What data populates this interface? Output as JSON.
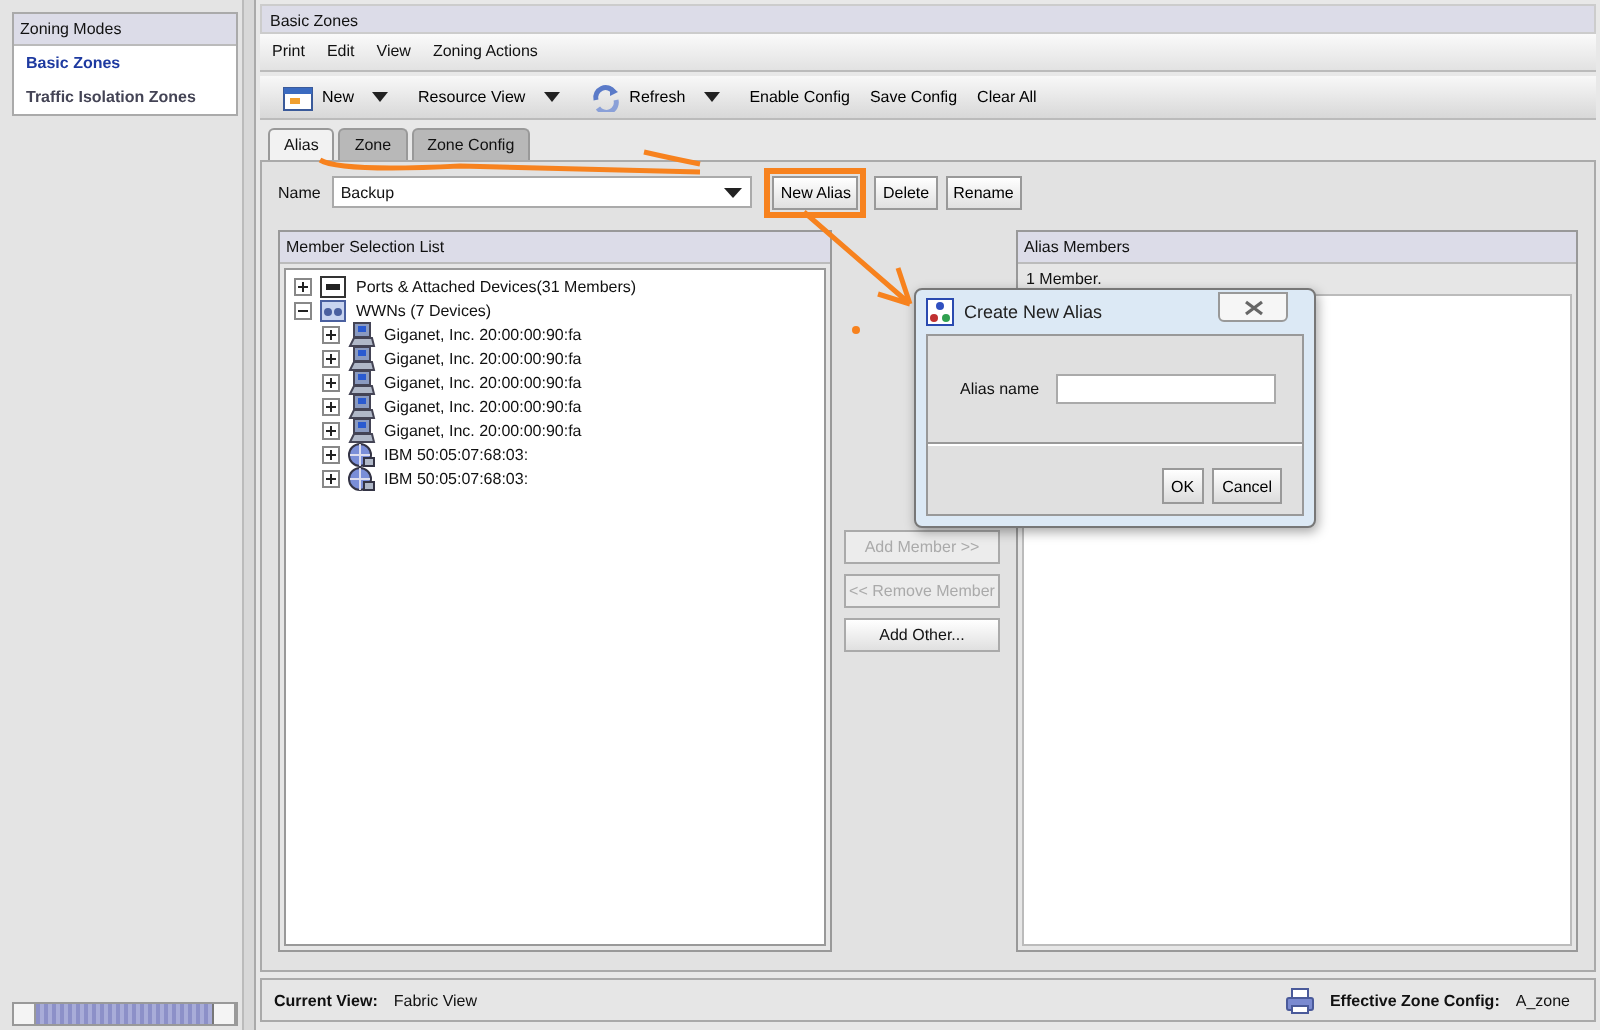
{
  "sidebar": {
    "title": "Zoning Modes",
    "items": [
      {
        "label": "Basic Zones",
        "selected": true
      },
      {
        "label": "Traffic Isolation Zones",
        "selected": false
      }
    ]
  },
  "main": {
    "title": "Basic Zones",
    "menu": [
      "Print",
      "Edit",
      "View",
      "Zoning Actions"
    ],
    "toolbar": [
      {
        "label": "New",
        "kind": "new",
        "dropdown": true
      },
      {
        "label": "Resource View",
        "kind": "plain",
        "dropdown": true
      },
      {
        "label": "Refresh",
        "kind": "refresh",
        "dropdown": true
      },
      {
        "label": "Enable Config",
        "kind": "plain",
        "dropdown": false
      },
      {
        "label": "Save Config",
        "kind": "plain",
        "dropdown": false
      },
      {
        "label": "Clear All",
        "kind": "plain",
        "dropdown": false
      }
    ],
    "tabs": [
      {
        "label": "Alias",
        "selected": true
      },
      {
        "label": "Zone",
        "selected": false
      },
      {
        "label": "Zone Config",
        "selected": false
      }
    ],
    "name_label": "Name",
    "name_value": "Backup",
    "name_buttons": [
      {
        "label": "New Alias",
        "highlighted": true
      },
      {
        "label": "Delete",
        "highlighted": false
      },
      {
        "label": "Rename",
        "highlighted": false
      }
    ],
    "member_list": {
      "title": "Member Selection List",
      "tree": [
        {
          "label": "Ports & Attached Devices(31 Members)",
          "kind": "port",
          "expanded": false
        },
        {
          "label": "WWNs (7 Devices)",
          "kind": "wwn",
          "expanded": true,
          "children": [
            {
              "label": "Giganet, Inc. 20:00:00:90:fa",
              "kind": "host",
              "expanded": false
            },
            {
              "label": "Giganet, Inc. 20:00:00:90:fa",
              "kind": "host",
              "expanded": false
            },
            {
              "label": "Giganet, Inc. 20:00:00:90:fa",
              "kind": "host",
              "expanded": false
            },
            {
              "label": "Giganet, Inc. 20:00:00:90:fa",
              "kind": "host",
              "expanded": false
            },
            {
              "label": "Giganet, Inc. 20:00:00:90:fa",
              "kind": "host",
              "expanded": false
            },
            {
              "label": "IBM 50:05:07:68:03:",
              "kind": "storage",
              "expanded": false
            },
            {
              "label": "IBM 50:05:07:68:03:",
              "kind": "storage",
              "expanded": false
            }
          ]
        }
      ]
    },
    "transfer_buttons": [
      {
        "label": "Add Member >>",
        "disabled": true
      },
      {
        "label": "<< Remove Member",
        "disabled": true
      },
      {
        "label": "Add Other...",
        "disabled": false
      }
    ],
    "alias_members": {
      "title": "Alias Members",
      "count": "1 Member."
    },
    "status": {
      "current_view_label": "Current View:",
      "current_view": "Fabric View",
      "effective_label": "Effective Zone Config:",
      "effective": "A_zone"
    }
  },
  "dialog": {
    "title": "Create New Alias",
    "field_label": "Alias name",
    "buttons": [
      "OK",
      "Cancel"
    ]
  }
}
